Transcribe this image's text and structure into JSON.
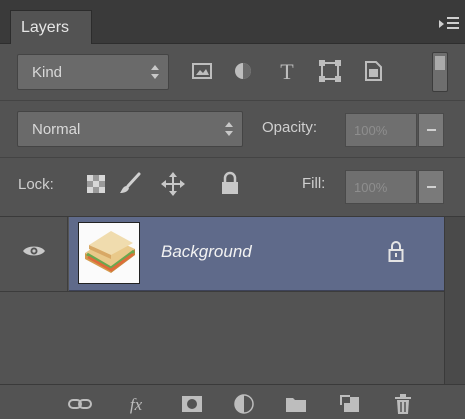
{
  "panel": {
    "tab": "Layers",
    "menu_icon": "panel-menu-icon"
  },
  "filter": {
    "kind_value": "Kind",
    "icons": [
      "image-filter-icon",
      "adjustment-filter-icon",
      "type-filter-icon",
      "shape-filter-icon",
      "smart-object-filter-icon"
    ],
    "toggle_icon": "filter-toggle-icon"
  },
  "blend": {
    "mode_value": "Normal",
    "opacity_label": "Opacity:",
    "opacity_value": "100%"
  },
  "lock": {
    "label": "Lock:",
    "icons": [
      "lock-transparent-pixels-icon",
      "lock-image-pixels-icon",
      "lock-position-icon",
      "lock-all-icon"
    ],
    "fill_label": "Fill:",
    "fill_value": "100%"
  },
  "layers": [
    {
      "name": "Background",
      "visible": true,
      "locked": true,
      "selected": true
    }
  ],
  "footer_icons": [
    "link-layers-icon",
    "add-layer-style-icon",
    "add-layer-mask-icon",
    "new-adjustment-layer-icon",
    "new-group-icon",
    "new-layer-icon",
    "delete-layer-icon"
  ],
  "colors": {
    "panel_bg": "#535353",
    "selected_row": "#5f6a8a",
    "tab_bar": "#3a3a3a"
  }
}
